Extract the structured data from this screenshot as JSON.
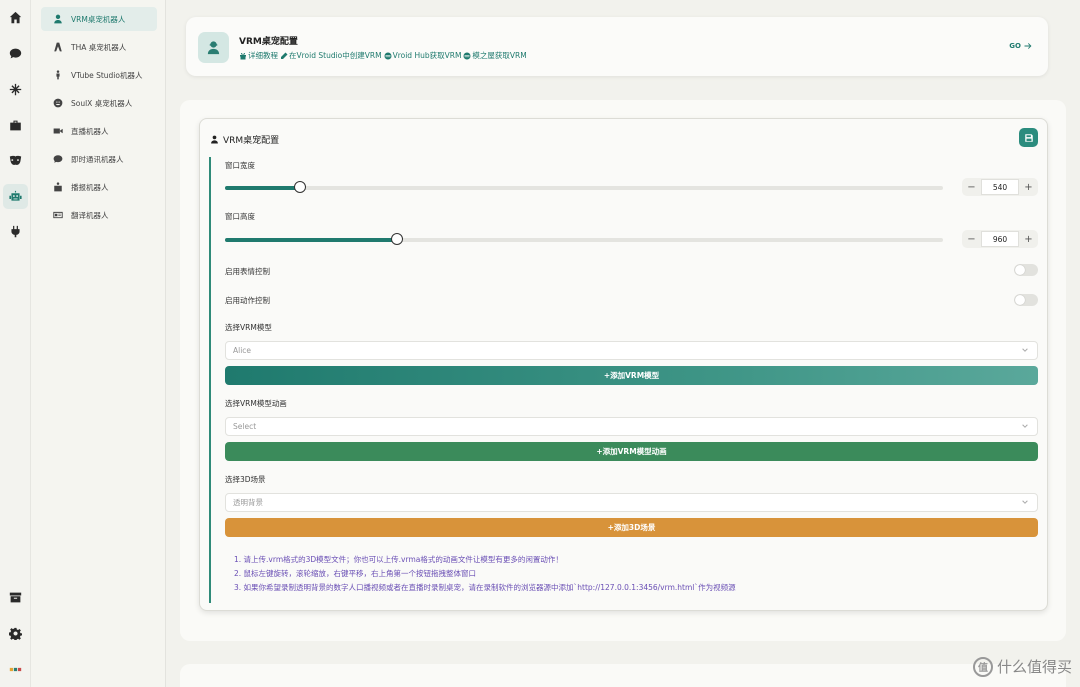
{
  "rail": {
    "icons": [
      "home-icon",
      "chat-icon",
      "snowflake-icon",
      "toolbox-icon",
      "mask-icon",
      "robot-icon",
      "plug-icon",
      "archive-icon",
      "gear-icon",
      "app-logo-icon"
    ]
  },
  "subnav": {
    "items": [
      {
        "label": "VRM桌宠机器人",
        "icon": "user-icon",
        "active": true
      },
      {
        "label": "THA 桌宠机器人",
        "icon": "ribbon-icon",
        "active": false
      },
      {
        "label": "VTube Studio机器人",
        "icon": "person-icon",
        "active": false
      },
      {
        "label": "SoulX 桌宠机器人",
        "icon": "smile-icon",
        "active": false
      },
      {
        "label": "直播机器人",
        "icon": "video-icon",
        "active": false
      },
      {
        "label": "即时通讯机器人",
        "icon": "chat-icon",
        "active": false
      },
      {
        "label": "播报机器人",
        "icon": "reader-icon",
        "active": false
      },
      {
        "label": "翻译机器人",
        "icon": "id-card-icon",
        "active": false
      }
    ]
  },
  "header": {
    "title": "VRM桌宠配置",
    "links": [
      "详细教程",
      "在Vroid Studio中创建VRM",
      "Vroid Hub获取VRM",
      "模之屋获取VRM"
    ],
    "go_label": "GO"
  },
  "panel": {
    "title": "VRM桌宠配置",
    "width_label": "窗口宽度",
    "width_value": "540",
    "width_fraction": 0.105,
    "height_label": "窗口高度",
    "height_value": "960",
    "height_fraction": 0.24,
    "expression_label": "启用表情控制",
    "expression_enabled": false,
    "motion_label": "启用动作控制",
    "motion_enabled": false,
    "model_label": "选择VRM模型",
    "model_value": "Alice",
    "add_model_button": "+添加VRM模型",
    "anim_label": "选择VRM模型动画",
    "anim_placeholder": "Select",
    "add_anim_button": "+添加VRM模型动画",
    "scene_label": "选择3D场景",
    "scene_value": "透明背景",
    "add_scene_button": "+添加3D场景",
    "notes": [
      "1. 请上传.vrm格式的3D模型文件；你也可以上传.vrma格式的动画文件让模型有更多的闲置动作！",
      "2. 鼠标左键旋转，滚轮缩放，右键平移，右上角第一个按钮拖拽整体窗口",
      "3. 如果你希望录制透明背景的数字人口播视频或者在直播时录制桌宠，请在录制软件的浏览器源中添加`http://127.0.0.1:3456/vrm.html`作为视频源"
    ]
  },
  "watermark": {
    "text": "什么值得买",
    "logo": "值"
  },
  "colors": {
    "accent": "#1f7a6e",
    "anim_button": "#3b8b5b",
    "scene_button": "#d8933a",
    "notes_text": "#6a4fb5"
  }
}
